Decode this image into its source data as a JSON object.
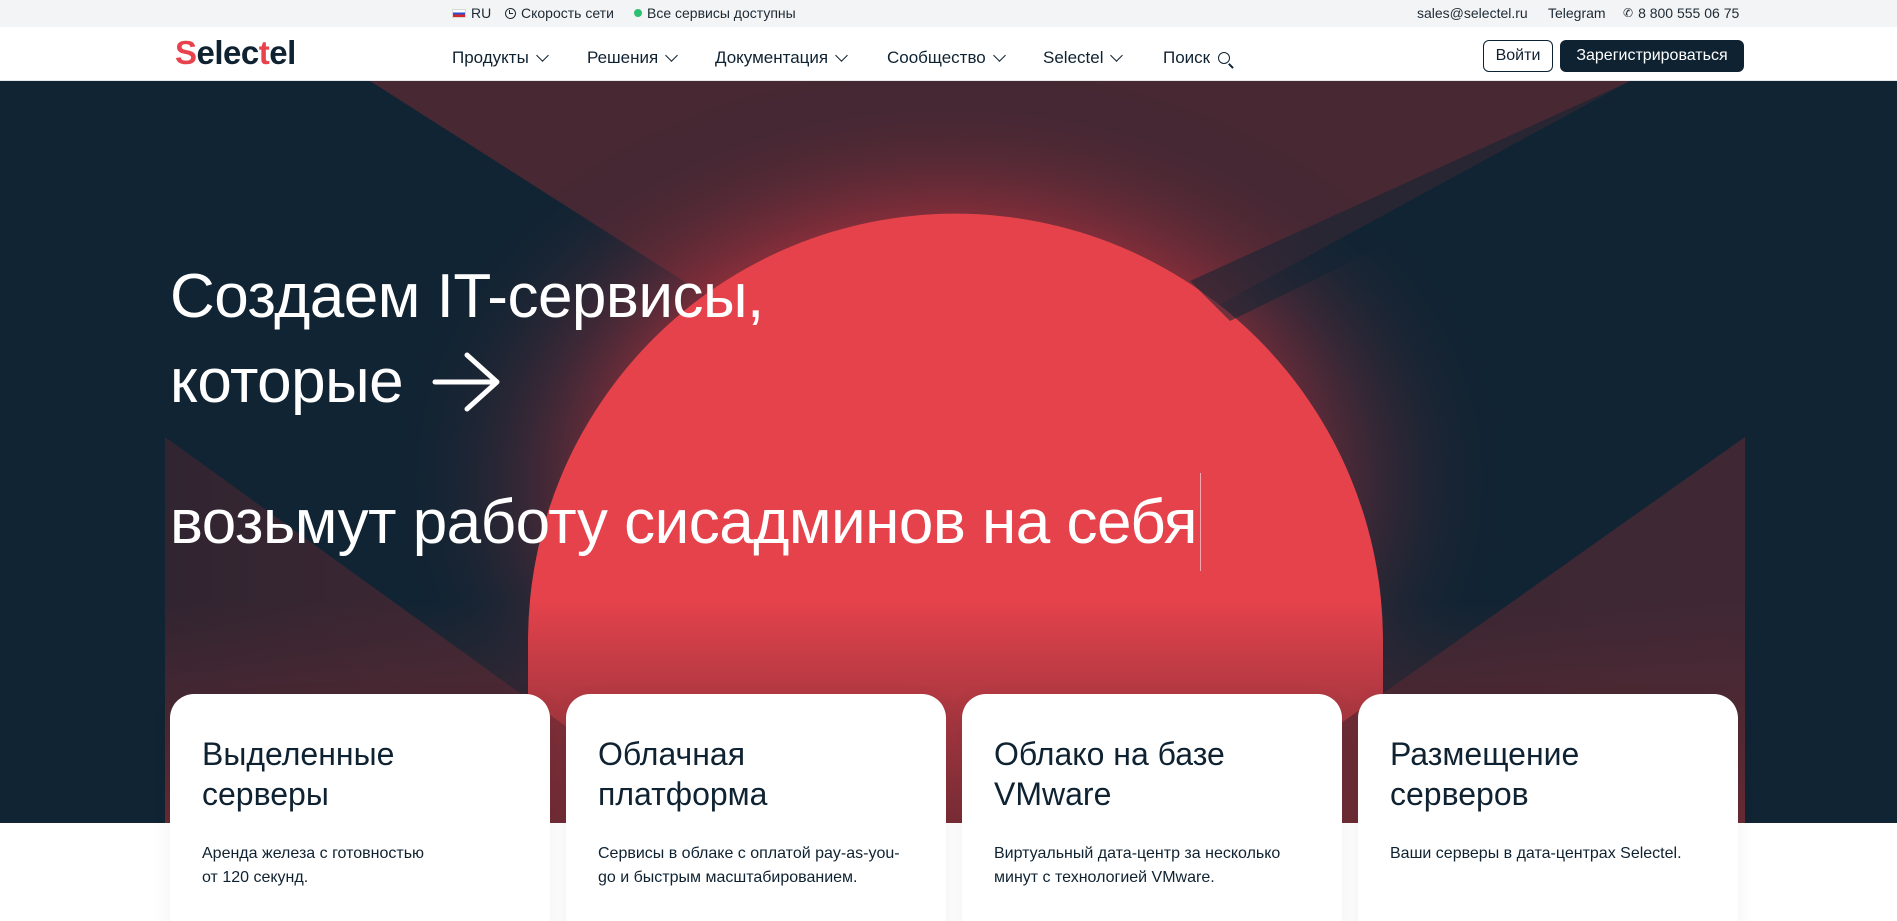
{
  "topbar": {
    "language": "RU",
    "network_speed": "Скорость сети",
    "status": "Все сервисы доступны",
    "email": "sales@selectel.ru",
    "telegram": "Telegram",
    "phone": "8 800 555 06 75"
  },
  "header": {
    "logo_text": "Selectel",
    "nav": {
      "products": "Продукты",
      "solutions": "Решения",
      "docs": "Документация",
      "community": "Сообщество",
      "selectel": "Selectel",
      "search": "Поиск"
    },
    "login_label": "Войти",
    "register_label": "Зарегистрироваться"
  },
  "hero": {
    "line1": "Создаем IT-сервисы,",
    "line2": "которые",
    "line3": "возьмут работу сисадминов на себя"
  },
  "cards": [
    {
      "title": "Выделенные\nсерверы",
      "desc": "Аренда железа с готовностью\nот 120 секунд."
    },
    {
      "title": "Облачная\nплатформа",
      "desc": "Сервисы в облаке с оплатой pay-as-you-\ngo и быстрым масштабированием."
    },
    {
      "title": "Облако на базе\nVMware",
      "desc": "Виртуальный дата-центр за несколько\nминут с технологией VMware."
    },
    {
      "title": "Размещение\nсерверов",
      "desc": "Ваши серверы в дата-центрах Selectel."
    }
  ],
  "colors": {
    "accent": "#e8424c",
    "dark": "#0f2231",
    "hero_bg": "#112433",
    "status_green": "#2fbf71"
  }
}
